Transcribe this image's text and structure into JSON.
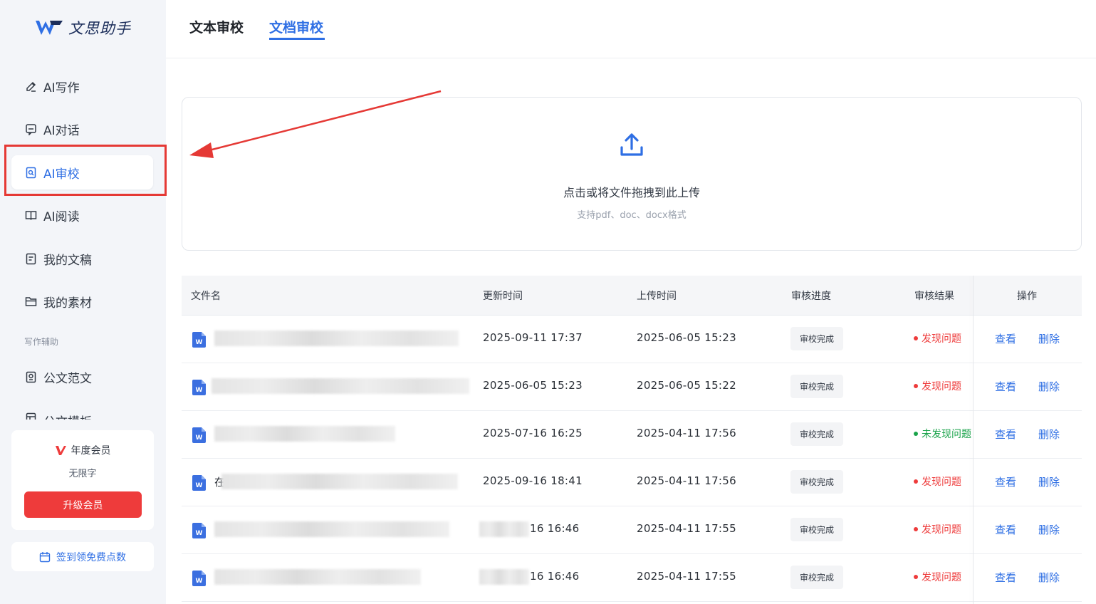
{
  "app": {
    "name": "文思助手"
  },
  "sidebar": {
    "items": [
      {
        "label": "AI写作",
        "icon": "pen-icon"
      },
      {
        "label": "AI对话",
        "icon": "chat-icon"
      },
      {
        "label": "AI审校",
        "icon": "doc-search-icon",
        "active": true
      },
      {
        "label": "AI阅读",
        "icon": "book-icon"
      },
      {
        "label": "我的文稿",
        "icon": "document-icon"
      },
      {
        "label": "我的素材",
        "icon": "folder-icon"
      }
    ],
    "section_label": "写作辅助",
    "assist_items": [
      {
        "label": "公文范文",
        "icon": "article-icon"
      },
      {
        "label": "公文模板",
        "icon": "template-icon"
      }
    ],
    "membership": {
      "title": "年度会员",
      "subtitle": "无限字",
      "upgrade_label": "升级会员"
    },
    "checkin_label": "签到领免费点数"
  },
  "tabs": [
    {
      "label": "文本审校",
      "active": false
    },
    {
      "label": "文档审校",
      "active": true
    }
  ],
  "upload": {
    "title": "点击或将文件拖拽到此上传",
    "hint": "支持pdf、doc、docx格式"
  },
  "table": {
    "headers": [
      "文件名",
      "更新时间",
      "上传时间",
      "审核进度",
      "审核结果",
      "操作"
    ],
    "rows": [
      {
        "name": "",
        "updated": "2025-09-11 17:37",
        "uploaded": "2025-06-05 15:23",
        "progress": "审校完成",
        "result": "发现问题",
        "found": true
      },
      {
        "name": "",
        "updated": "2025-06-05 15:23",
        "uploaded": "2025-06-05 15:22",
        "progress": "审校完成",
        "result": "发现问题",
        "found": true
      },
      {
        "name": "",
        "updated": "2025-07-16 16:25",
        "uploaded": "2025-04-11 17:56",
        "progress": "审校完成",
        "result": "未发现问题",
        "found": false
      },
      {
        "name": "在",
        "updated": "2025-09-16 18:41",
        "uploaded": "2025-04-11 17:56",
        "progress": "审校完成",
        "result": "发现问题",
        "found": true
      },
      {
        "name": "",
        "updated": "16 16:46",
        "uploaded": "2025-04-11 17:55",
        "progress": "审校完成",
        "result": "发现问题",
        "found": true
      },
      {
        "name": "",
        "updated": "16 16:46",
        "uploaded": "2025-04-11 17:55",
        "progress": "审校完成",
        "result": "发现问题",
        "found": true
      }
    ],
    "actions": {
      "view": "查看",
      "delete": "删除"
    }
  },
  "colors": {
    "accent": "#2f6fe4",
    "danger": "#ee3b3b",
    "success": "#1aa34a",
    "annotation": "#e53935"
  }
}
